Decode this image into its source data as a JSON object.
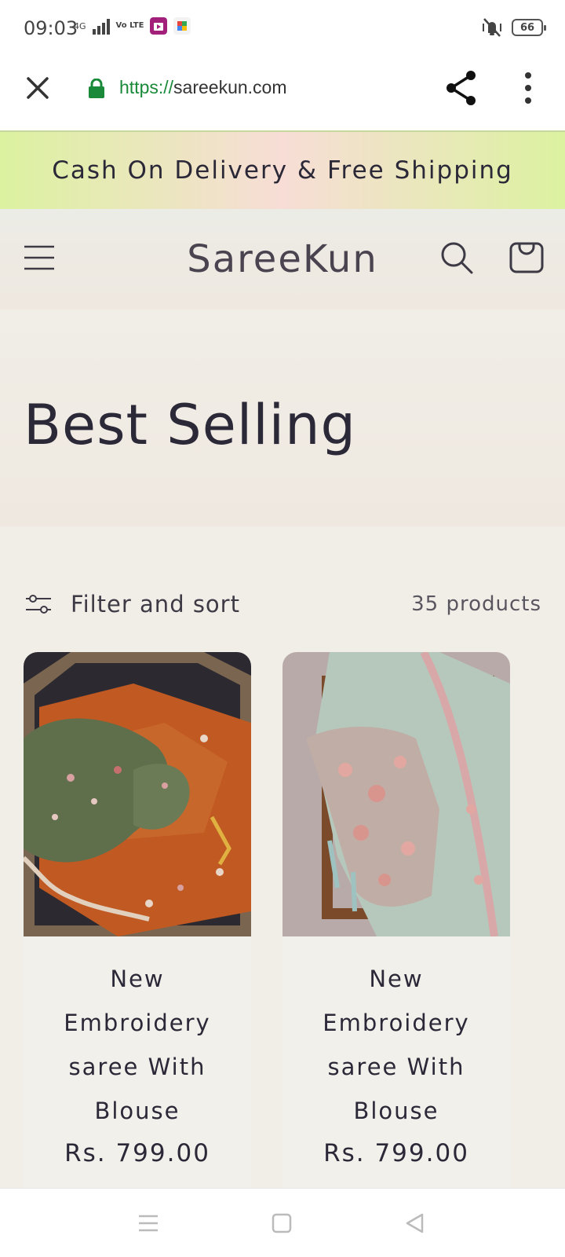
{
  "status_bar": {
    "time": "09:03",
    "network": "4G",
    "volte": "Vo LTE",
    "battery": "66"
  },
  "browser": {
    "url_scheme": "https://",
    "url_host": "sareekun.com"
  },
  "announcement": "Cash On Delivery & Free Shipping",
  "store": {
    "name": "SareeKun"
  },
  "collection": {
    "title": "Best Selling",
    "filter_label": "Filter and sort",
    "product_count": "35 products"
  },
  "products": [
    {
      "title": "New Embroidery saree With Blouse",
      "price": "Rs. 799.00"
    },
    {
      "title": "New Embroidery saree With Blouse",
      "price": "Rs. 799.00"
    }
  ],
  "colors": {
    "accent_text": "#2b2838",
    "secure_green": "#1a8a3a",
    "announce_green": "#dcf2a0",
    "announce_pink": "#f7ddd6",
    "page_bg": "#f1eee8"
  },
  "icons": {
    "close": "close-icon",
    "lock": "lock-icon",
    "share": "share-icon",
    "menu": "more-vertical-icon",
    "hamburger": "hamburger-icon",
    "search": "search-icon",
    "cart": "cart-icon",
    "filter": "sliders-icon",
    "nav_menu": "recent-apps-icon",
    "nav_home": "home-icon",
    "nav_back": "back-icon"
  }
}
